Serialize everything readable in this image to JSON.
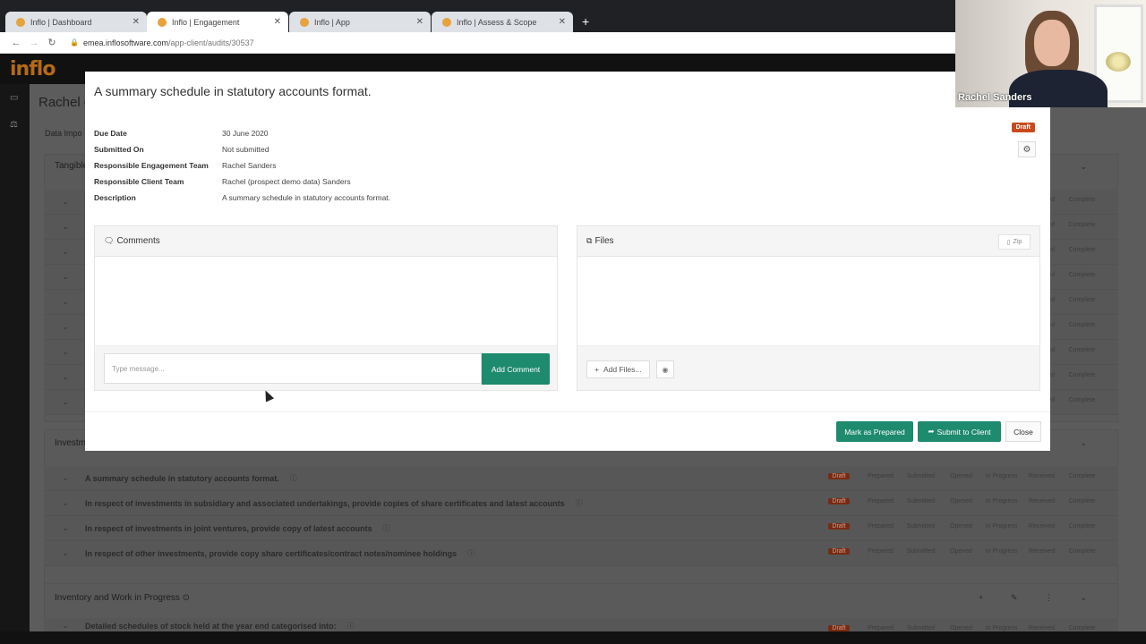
{
  "browser": {
    "tabs": [
      {
        "label": "Inflo | Dashboard"
      },
      {
        "label": "Inflo | Engagement"
      },
      {
        "label": "Inflo | App"
      },
      {
        "label": "Inflo | Assess & Scope"
      }
    ],
    "url_host": "emea.inflosoftware.com",
    "url_path": "/app-client/audits/30537"
  },
  "app": {
    "logo": "inflo",
    "page_title": "Rachel c",
    "sub_nav": "Data Impo",
    "sections": [
      {
        "title": "Tangible"
      },
      {
        "title": "Investm"
      },
      {
        "title": "Inventory and Work in Progress"
      }
    ],
    "investment_rows": [
      {
        "text": "A summary schedule in statutory accounts format."
      },
      {
        "text": "In respect of investments in subsidiary and associated undertakings, provide copies of share certificates and latest accounts"
      },
      {
        "text": "In respect of investments in joint ventures, provide copy of latest accounts"
      },
      {
        "text": "In respect of other investments, provide copy share certificates/contract notes/nominee holdings"
      }
    ],
    "inventory_rows": [
      {
        "text": "Detailed schedules of stock held at the year end categorised into:"
      }
    ],
    "status_labels": [
      "Draft",
      "Prepared",
      "Submitted",
      "Opened",
      "In Progress",
      "Received",
      "Complete"
    ],
    "status_labels_partial": [
      "Received",
      "Complete"
    ],
    "colors": {
      "accent": "#1e8a6e",
      "draft": "#c84a1d",
      "logo": "#b56a16"
    }
  },
  "modal": {
    "title": "A summary schedule in statutory accounts format.",
    "details": [
      {
        "label": "Due Date",
        "value": "30 June 2020"
      },
      {
        "label": "Submitted On",
        "value": "Not submitted"
      },
      {
        "label": "Responsible Engagement Team",
        "value": "Rachel Sanders"
      },
      {
        "label": "Responsible Client Team",
        "value": "Rachel (prospect demo data) Sanders"
      },
      {
        "label": "Description",
        "value": "A summary schedule in statutory accounts format."
      }
    ],
    "status_badge": "Draft",
    "comments": {
      "title": "Comments",
      "placeholder": "Type message...",
      "add_label": "Add Comment"
    },
    "files": {
      "title": "Files",
      "zip_label": "Zip",
      "add_label": "Add Files..."
    },
    "buttons": {
      "mark_prepared": "Mark as Prepared",
      "submit_client": "Submit to Client",
      "close": "Close"
    }
  },
  "webcam": {
    "name": "Rachel Sanders"
  }
}
